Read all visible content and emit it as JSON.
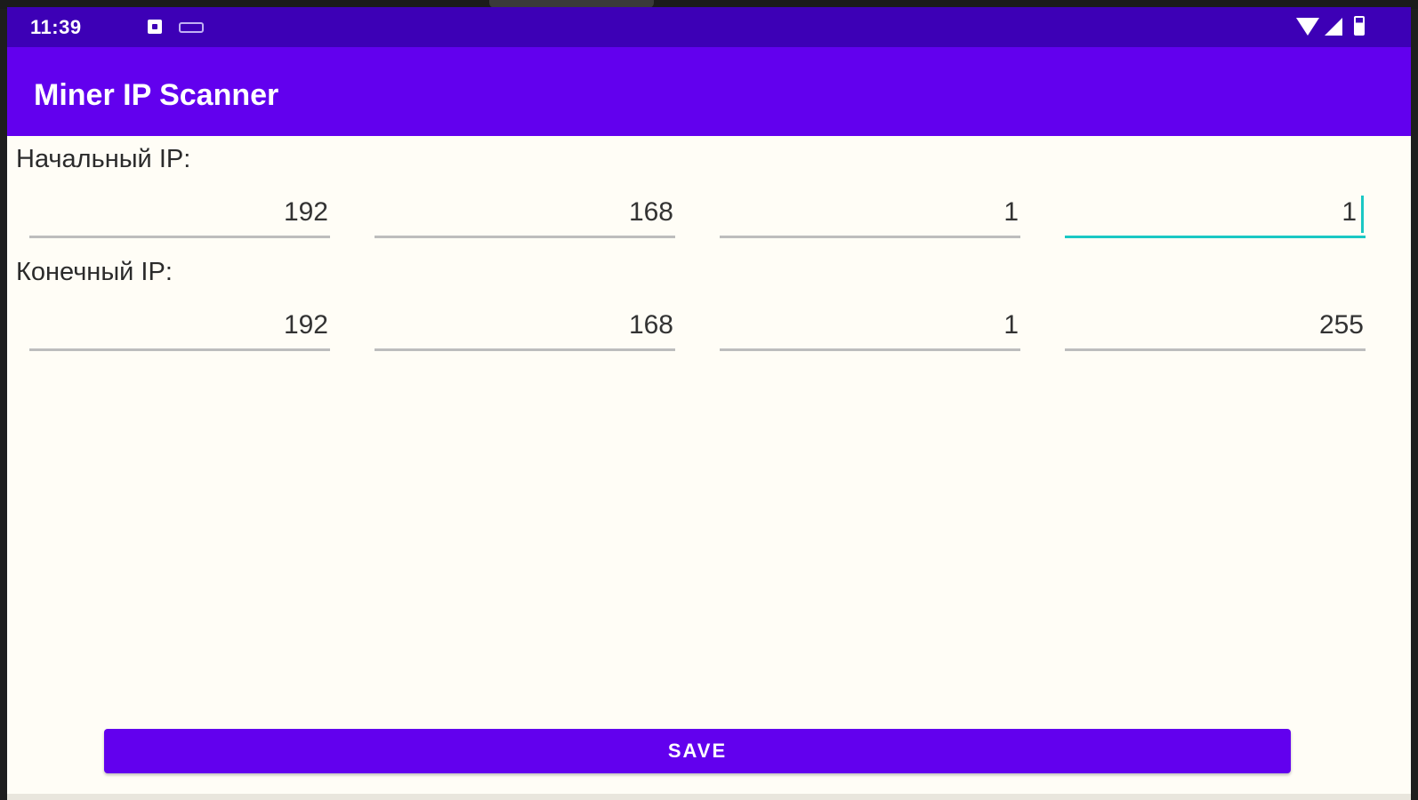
{
  "status_bar": {
    "time": "11:39",
    "icons": [
      "notification-square-icon",
      "keyboard-icon",
      "wifi-icon",
      "signal-icon",
      "battery-icon"
    ]
  },
  "app_bar": {
    "title": "Miner IP Scanner"
  },
  "start_ip": {
    "label": "Начальный IP:",
    "octets": [
      "192",
      "168",
      "1",
      "1"
    ]
  },
  "end_ip": {
    "label": "Конечный IP:",
    "octets": [
      "192",
      "168",
      "1",
      "255"
    ]
  },
  "actions": {
    "save_label": "SAVE"
  },
  "colors": {
    "status_bar": "#3d00b6",
    "primary": "#6200ee",
    "focus_accent": "#1ac8c4",
    "background": "#fffdf6"
  }
}
